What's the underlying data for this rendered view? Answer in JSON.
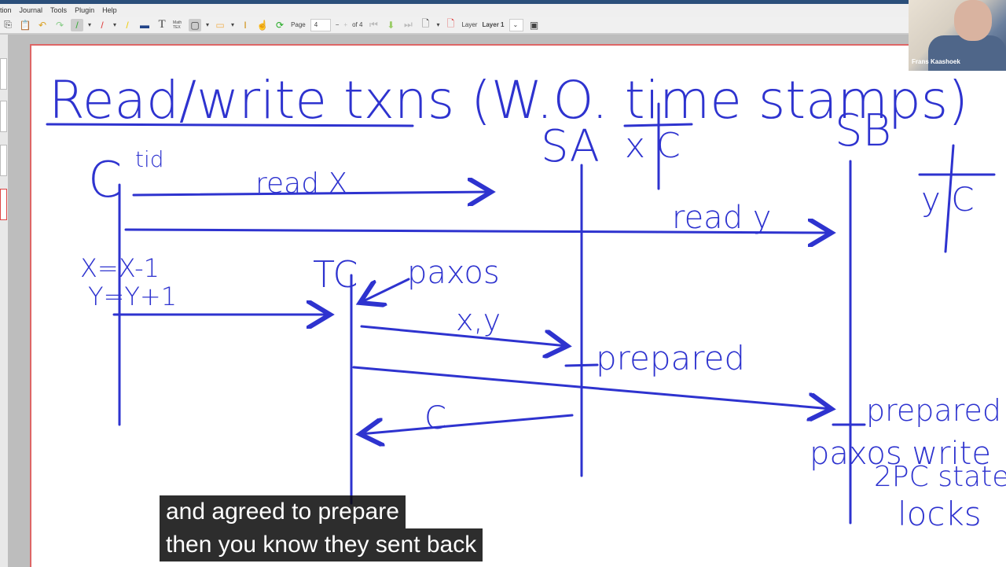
{
  "menu": [
    "tion",
    "Journal",
    "Tools",
    "Plugin",
    "Help"
  ],
  "toolbar": {
    "page_label": "Page",
    "page_value": "4",
    "page_total": "of 4",
    "layer_label": "Layer",
    "layer_value": "Layer 1",
    "math_tex": "Math TEX"
  },
  "webcam": {
    "name": "Frans Kaashoek"
  },
  "whiteboard": {
    "title": "Read/write txns (W.O. time stamps)",
    "client": "C",
    "tid": "tid",
    "read_x": "read X",
    "read_y": "read y",
    "sa": "SA",
    "sa_table": "x C",
    "sb": "SB",
    "sb_table": "y C",
    "x_update": "X=X-1",
    "y_update": "Y=Y+1",
    "tc": "TC",
    "paxos": "paxos",
    "xy": "x,y",
    "prepared_a": "prepared",
    "prepared_b": "prepared",
    "commit": "C",
    "paxos_write": "paxos write",
    "twopc_state": "2PC state",
    "locks": "locks"
  },
  "subtitles": [
    "and agreed to prepare",
    "then you know they sent back"
  ],
  "colors": {
    "ink": "#2e33cf",
    "page_border": "#dd6666"
  }
}
